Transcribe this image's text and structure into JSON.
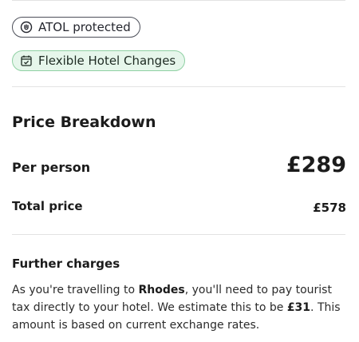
{
  "badges": {
    "atol": {
      "label": "ATOL protected",
      "icon": "atol-shield-icon"
    },
    "flexible": {
      "label": "Flexible Hotel Changes",
      "icon": "calendar-check-icon"
    }
  },
  "price_breakdown": {
    "title": "Price Breakdown",
    "per_person": {
      "label": "Per person",
      "value": "£289"
    },
    "total": {
      "label": "Total price",
      "value": "£578"
    }
  },
  "further_charges": {
    "heading": "Further charges",
    "text_part1": "As you're travelling to ",
    "destination": "Rhodes",
    "text_part2": ", you'll need to pay tourist tax directly to your hotel. We estimate this to be ",
    "amount": "£31",
    "text_part3": ". This amount is based on current exchange rates."
  },
  "colors": {
    "flex_badge_bg": "#e6f6eb",
    "flex_badge_border": "#8fd0a3",
    "atol_badge_border": "#4c4f59"
  }
}
